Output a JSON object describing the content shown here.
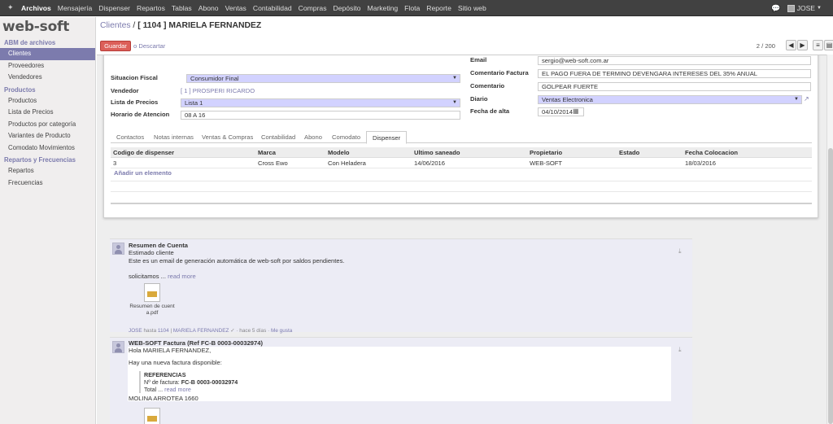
{
  "topnav": {
    "items": [
      "Archivos",
      "Mensajería",
      "Dispenser",
      "Repartos",
      "Tablas",
      "Abono",
      "Ventas",
      "Contabilidad",
      "Compras",
      "Depósito",
      "Marketing",
      "Flota",
      "Reporte",
      "Sitio web"
    ],
    "user": "JOSE"
  },
  "sidebar": {
    "logo": "web-soft",
    "sections": [
      {
        "title": "ABM de archivos",
        "items": [
          "Clientes",
          "Proveedores",
          "Vendedores"
        ]
      },
      {
        "title": "Productos",
        "items": [
          "Productos",
          "Lista de Precios",
          "Productos por categoría",
          "Variantes de Producto",
          "Comodato Movimientos"
        ]
      },
      {
        "title": "Repartos y Frecuencias",
        "items": [
          "Repartos",
          "Frecuencias"
        ]
      }
    ]
  },
  "header": {
    "breadcrumb_parent": "Clientes",
    "breadcrumb_sep": " / ",
    "breadcrumb_current": "[ 1104 ] MARIELA FERNANDEZ",
    "save_label": "Guardar",
    "discard_label": "o Descartar",
    "pager": "2 / 200"
  },
  "form": {
    "left": {
      "situacion_fiscal_label": "Situacion Fiscal",
      "situacion_fiscal": "Consumidor Final",
      "vendedor_label": "Vendedor",
      "vendedor": "[ 1 ] PROSPERI RICARDO",
      "lista_precios_label": "Lista de Precios",
      "lista_precios": "Lista 1",
      "horario_label": "Horario de Atencion",
      "horario": "08 A 16"
    },
    "right": {
      "email_label": "Email",
      "email": "sergio@web-soft.com.ar",
      "comentario_factura_label": "Comentario Factura",
      "comentario_factura": "EL PAGO FUERA DE TERMINO DEVENGARA INTERESES DEL 35% ANUAL",
      "comentario_label": "Comentario",
      "comentario": "GOLPEAR FUERTE",
      "diario_label": "Diario",
      "diario": "Ventas Electronica",
      "fecha_alta_label": "Fecha de alta",
      "fecha_alta": "04/10/2014"
    }
  },
  "tabs": [
    "Contactos",
    "Notas internas",
    "Ventas & Compras",
    "Contabilidad",
    "Abono",
    "Comodato",
    "Dispenser"
  ],
  "dispenser_table": {
    "headers": [
      "Codigo de dispenser",
      "Marca",
      "Modelo",
      "Ultimo saneado",
      "Propietario",
      "Estado",
      "Fecha Colocacion"
    ],
    "rows": [
      [
        "3",
        "Cross Ewo",
        "Con Heladera",
        "14/06/2016",
        "WEB-SOFT",
        "",
        "18/03/2016"
      ]
    ],
    "add_label": "Añadir un elemento"
  },
  "chatter": {
    "msg1": {
      "subject": "Resumen de Cuenta",
      "line1": "Estimado cliente",
      "line2": "Este es un email de generación automática de web-soft por saldos pendientes.",
      "line3": "solicitamos ...",
      "read_more": "read more",
      "attachment_l1": "Resumen de cuent",
      "attachment_l2": "a.pdf",
      "foot_author": "JOSE",
      "foot_to": "hasta",
      "foot_record": "1104",
      "foot_sep": "|",
      "foot_partner": "MARIELA FERNANDEZ",
      "foot_time": "· hace 5 días ·",
      "foot_like": "Me gusta"
    },
    "msg2": {
      "subject": "WEB-SOFT Factura (Ref FC-B 0003-00032974)",
      "line1": "Hola MARIELA FERNANDEZ,",
      "line2": "Hay una nueva factura disponible:",
      "ref_title": "REFERENCIAS",
      "ref_num_label": "Nº de factura:",
      "ref_num": "FC-B 0003-00032974",
      "ref_total": "Total ...",
      "read_more": "read more",
      "address": "MOLINA ARROTEA 1660"
    }
  }
}
